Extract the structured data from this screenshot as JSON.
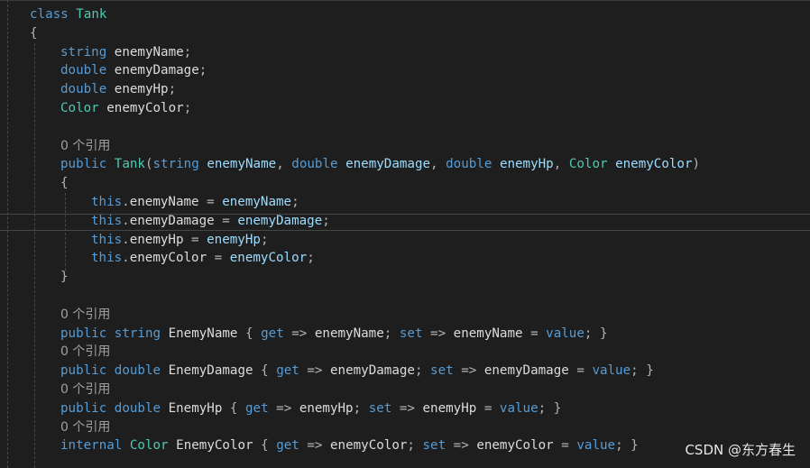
{
  "code_lines": [
    {
      "type": "code",
      "indent": 0,
      "tokens": [
        {
          "t": "class",
          "c": "kw"
        },
        {
          "t": " "
        },
        {
          "t": "Tank",
          "c": "ty"
        }
      ]
    },
    {
      "type": "code",
      "indent": 0,
      "tokens": [
        {
          "t": "{",
          "c": "pu"
        }
      ]
    },
    {
      "type": "code",
      "indent": 1,
      "tokens": [
        {
          "t": "string",
          "c": "kw"
        },
        {
          "t": " "
        },
        {
          "t": "enemyName",
          "c": "id"
        },
        {
          "t": ";",
          "c": "pu"
        }
      ]
    },
    {
      "type": "code",
      "indent": 1,
      "tokens": [
        {
          "t": "double",
          "c": "kw"
        },
        {
          "t": " "
        },
        {
          "t": "enemyDamage",
          "c": "id"
        },
        {
          "t": ";",
          "c": "pu"
        }
      ]
    },
    {
      "type": "code",
      "indent": 1,
      "tokens": [
        {
          "t": "double",
          "c": "kw"
        },
        {
          "t": " "
        },
        {
          "t": "enemyHp",
          "c": "id"
        },
        {
          "t": ";",
          "c": "pu"
        }
      ]
    },
    {
      "type": "code",
      "indent": 1,
      "tokens": [
        {
          "t": "Color",
          "c": "ty"
        },
        {
          "t": " "
        },
        {
          "t": "enemyColor",
          "c": "id"
        },
        {
          "t": ";",
          "c": "pu"
        }
      ]
    },
    {
      "type": "blank"
    },
    {
      "type": "codelens",
      "indent": 1,
      "text": "0 个引用"
    },
    {
      "type": "code",
      "indent": 1,
      "tokens": [
        {
          "t": "public",
          "c": "kw"
        },
        {
          "t": " "
        },
        {
          "t": "Tank",
          "c": "ty"
        },
        {
          "t": "(",
          "c": "pu"
        },
        {
          "t": "string",
          "c": "kw"
        },
        {
          "t": " "
        },
        {
          "t": "enemyName",
          "c": "pa"
        },
        {
          "t": ", ",
          "c": "pu"
        },
        {
          "t": "double",
          "c": "kw"
        },
        {
          "t": " "
        },
        {
          "t": "enemyDamage",
          "c": "pa"
        },
        {
          "t": ", ",
          "c": "pu"
        },
        {
          "t": "double",
          "c": "kw"
        },
        {
          "t": " "
        },
        {
          "t": "enemyHp",
          "c": "pa"
        },
        {
          "t": ", ",
          "c": "pu"
        },
        {
          "t": "Color",
          "c": "ty"
        },
        {
          "t": " "
        },
        {
          "t": "enemyColor",
          "c": "pa"
        },
        {
          "t": ")",
          "c": "pu"
        }
      ]
    },
    {
      "type": "code",
      "indent": 1,
      "tokens": [
        {
          "t": "{",
          "c": "pu"
        }
      ]
    },
    {
      "type": "code",
      "indent": 2,
      "tokens": [
        {
          "t": "this",
          "c": "kw"
        },
        {
          "t": ".",
          "c": "pu"
        },
        {
          "t": "enemyName",
          "c": "id"
        },
        {
          "t": " = ",
          "c": "pu"
        },
        {
          "t": "enemyName",
          "c": "pa"
        },
        {
          "t": ";",
          "c": "pu"
        }
      ]
    },
    {
      "type": "code",
      "indent": 2,
      "tokens": [
        {
          "t": "this",
          "c": "kw"
        },
        {
          "t": ".",
          "c": "pu"
        },
        {
          "t": "enemyDamage",
          "c": "id"
        },
        {
          "t": " = ",
          "c": "pu"
        },
        {
          "t": "enemyDamage",
          "c": "pa"
        },
        {
          "t": ";",
          "c": "pu"
        }
      ]
    },
    {
      "type": "code",
      "indent": 2,
      "tokens": [
        {
          "t": "this",
          "c": "kw"
        },
        {
          "t": ".",
          "c": "pu"
        },
        {
          "t": "enemyHp",
          "c": "id"
        },
        {
          "t": " = ",
          "c": "pu"
        },
        {
          "t": "enemyHp",
          "c": "pa"
        },
        {
          "t": ";",
          "c": "pu"
        }
      ]
    },
    {
      "type": "code",
      "indent": 2,
      "tokens": [
        {
          "t": "this",
          "c": "kw"
        },
        {
          "t": ".",
          "c": "pu"
        },
        {
          "t": "enemyColor",
          "c": "id"
        },
        {
          "t": " = ",
          "c": "pu"
        },
        {
          "t": "enemyColor",
          "c": "pa"
        },
        {
          "t": ";",
          "c": "pu"
        }
      ]
    },
    {
      "type": "code",
      "indent": 1,
      "tokens": [
        {
          "t": "}",
          "c": "pu"
        }
      ]
    },
    {
      "type": "blank"
    },
    {
      "type": "codelens",
      "indent": 1,
      "text": "0 个引用"
    },
    {
      "type": "code",
      "indent": 1,
      "tokens": [
        {
          "t": "public",
          "c": "kw"
        },
        {
          "t": " "
        },
        {
          "t": "string",
          "c": "kw"
        },
        {
          "t": " "
        },
        {
          "t": "EnemyName",
          "c": "id"
        },
        {
          "t": " { ",
          "c": "pu"
        },
        {
          "t": "get",
          "c": "kw"
        },
        {
          "t": " => ",
          "c": "pu"
        },
        {
          "t": "enemyName",
          "c": "id"
        },
        {
          "t": "; ",
          "c": "pu"
        },
        {
          "t": "set",
          "c": "kw"
        },
        {
          "t": " => ",
          "c": "pu"
        },
        {
          "t": "enemyName",
          "c": "id"
        },
        {
          "t": " = ",
          "c": "pu"
        },
        {
          "t": "value",
          "c": "kw"
        },
        {
          "t": "; }",
          "c": "pu"
        }
      ]
    },
    {
      "type": "codelens",
      "indent": 1,
      "text": "0 个引用"
    },
    {
      "type": "code",
      "indent": 1,
      "tokens": [
        {
          "t": "public",
          "c": "kw"
        },
        {
          "t": " "
        },
        {
          "t": "double",
          "c": "kw"
        },
        {
          "t": " "
        },
        {
          "t": "EnemyDamage",
          "c": "id"
        },
        {
          "t": " { ",
          "c": "pu"
        },
        {
          "t": "get",
          "c": "kw"
        },
        {
          "t": " => ",
          "c": "pu"
        },
        {
          "t": "enemyDamage",
          "c": "id"
        },
        {
          "t": "; ",
          "c": "pu"
        },
        {
          "t": "set",
          "c": "kw"
        },
        {
          "t": " => ",
          "c": "pu"
        },
        {
          "t": "enemyDamage",
          "c": "id"
        },
        {
          "t": " = ",
          "c": "pu"
        },
        {
          "t": "value",
          "c": "kw"
        },
        {
          "t": "; }",
          "c": "pu"
        }
      ]
    },
    {
      "type": "codelens",
      "indent": 1,
      "text": "0 个引用"
    },
    {
      "type": "code",
      "indent": 1,
      "tokens": [
        {
          "t": "public",
          "c": "kw"
        },
        {
          "t": " "
        },
        {
          "t": "double",
          "c": "kw"
        },
        {
          "t": " "
        },
        {
          "t": "EnemyHp",
          "c": "id"
        },
        {
          "t": " { ",
          "c": "pu"
        },
        {
          "t": "get",
          "c": "kw"
        },
        {
          "t": " => ",
          "c": "pu"
        },
        {
          "t": "enemyHp",
          "c": "id"
        },
        {
          "t": "; ",
          "c": "pu"
        },
        {
          "t": "set",
          "c": "kw"
        },
        {
          "t": " => ",
          "c": "pu"
        },
        {
          "t": "enemyHp",
          "c": "id"
        },
        {
          "t": " = ",
          "c": "pu"
        },
        {
          "t": "value",
          "c": "kw"
        },
        {
          "t": "; }",
          "c": "pu"
        }
      ]
    },
    {
      "type": "codelens",
      "indent": 1,
      "text": "0 个引用"
    },
    {
      "type": "code",
      "indent": 1,
      "tokens": [
        {
          "t": "internal",
          "c": "kw"
        },
        {
          "t": " "
        },
        {
          "t": "Color",
          "c": "ty"
        },
        {
          "t": " "
        },
        {
          "t": "EnemyColor",
          "c": "id"
        },
        {
          "t": " { ",
          "c": "pu"
        },
        {
          "t": "get",
          "c": "kw"
        },
        {
          "t": " => ",
          "c": "pu"
        },
        {
          "t": "enemyColor",
          "c": "id"
        },
        {
          "t": "; ",
          "c": "pu"
        },
        {
          "t": "set",
          "c": "kw"
        },
        {
          "t": " => ",
          "c": "pu"
        },
        {
          "t": "enemyColor",
          "c": "id"
        },
        {
          "t": " = ",
          "c": "pu"
        },
        {
          "t": "value",
          "c": "kw"
        },
        {
          "t": "; }",
          "c": "pu"
        }
      ]
    }
  ],
  "watermark": "CSDN @东方春生",
  "colors": {
    "background": "#1e1e1e",
    "keyword": "#569cd6",
    "type": "#4ec9b0",
    "identifier": "#dcdcdc",
    "parameter": "#9cdcfe",
    "codelens": "#a0a0a0"
  }
}
